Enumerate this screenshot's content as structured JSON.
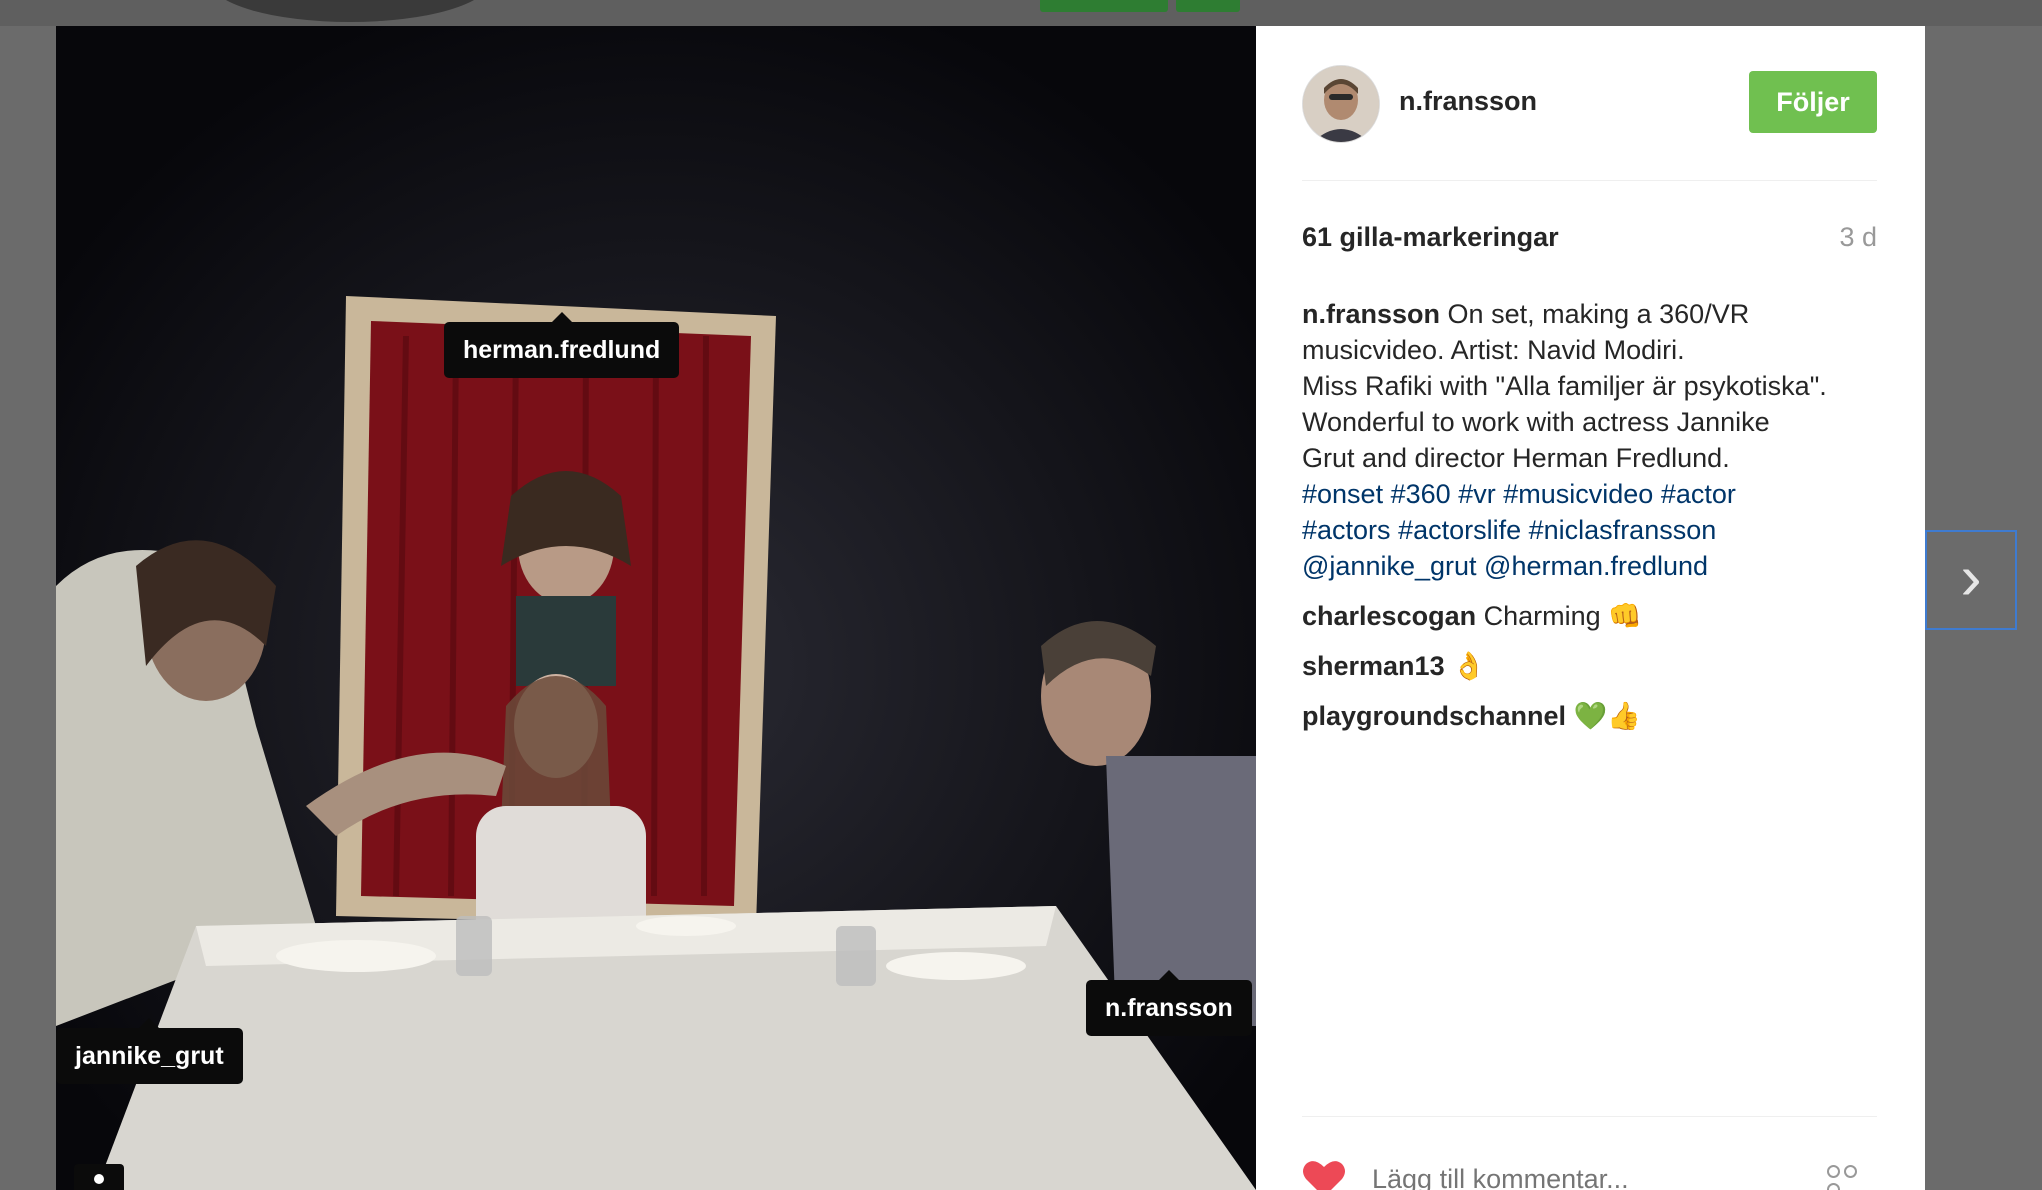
{
  "post": {
    "username": "n.fransson",
    "follow_label": "Följer",
    "likes": "61 gilla-markeringar",
    "age": "3 d",
    "caption": {
      "user": "n.fransson",
      "line1": "On set, making a 360/VR",
      "line2": "musicvideo. Artist: Navid Modiri.",
      "line3": "Miss Rafiki with \"Alla familjer är psykotiska\".",
      "line4": "Wonderful to work with actress Jannike",
      "line5": "Grut and director Herman Fredlund.",
      "hashtags_line1": [
        "#onset",
        "#360",
        "#vr",
        "#musicvideo",
        "#actor"
      ],
      "hashtags_line2": [
        "#actors",
        "#actorslife",
        "#niclasfransson"
      ],
      "mentions": [
        "@jannike_grut",
        "@herman.fredlund"
      ]
    },
    "comments": [
      {
        "user": "charlescogan",
        "text": "Charming 👊"
      },
      {
        "user": "sherman13",
        "text": "👌"
      },
      {
        "user": "playgroundschannel",
        "text": "💚👍"
      }
    ],
    "comment_placeholder": "Lägg till kommentar...",
    "photo_tags": [
      "herman.fredlund",
      "jannike_grut",
      "n.fransson"
    ]
  },
  "icons": {
    "heart": "heart-icon",
    "more": "more-options-icon",
    "next": "chevron-right-icon"
  },
  "colors": {
    "follow_bg": "#70c050",
    "link": "#003569",
    "heart": "#ed4956"
  }
}
